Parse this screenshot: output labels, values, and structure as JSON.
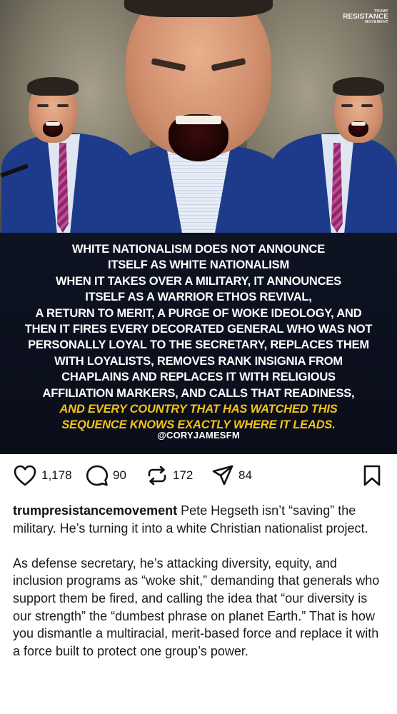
{
  "post_image": {
    "watermark": {
      "top": "TRUMP",
      "mid": "RESISTANCE",
      "bot": "MOVEMENT"
    },
    "quote_lines": [
      {
        "text": "WHITE NATIONALISM DOES NOT ANNOUNCE",
        "highlight": false
      },
      {
        "text": "ITSELF AS WHITE NATIONALISM",
        "highlight": false
      },
      {
        "text": "WHEN IT TAKES OVER A MILITARY, IT ANNOUNCES",
        "highlight": false
      },
      {
        "text": "ITSELF AS A WARRIOR ETHOS REVIVAL,",
        "highlight": false
      },
      {
        "text": "A RETURN TO MERIT, A PURGE OF WOKE IDEOLOGY, AND",
        "highlight": false
      },
      {
        "text": "THEN IT FIRES EVERY DECORATED GENERAL WHO WAS NOT",
        "highlight": false
      },
      {
        "text": "PERSONALLY LOYAL TO THE SECRETARY, REPLACES THEM",
        "highlight": false
      },
      {
        "text": "WITH LOYALISTS, REMOVES RANK INSIGNIA FROM",
        "highlight": false
      },
      {
        "text": "CHAPLAINS AND REPLACES IT WITH RELIGIOUS",
        "highlight": false
      },
      {
        "text": "AFFILIATION MARKERS, AND CALLS THAT READINESS,",
        "highlight": false
      },
      {
        "text": "AND EVERY COUNTRY THAT HAS WATCHED THIS",
        "highlight": true
      },
      {
        "text": "SEQUENCE KNOWS EXACTLY WHERE IT LEADS.",
        "highlight": true
      }
    ],
    "handle": "@CORYJAMESFM"
  },
  "actions": {
    "likes": "1,178",
    "comments": "90",
    "reposts": "172",
    "shares": "84",
    "icons": {
      "like": "heart-icon",
      "comment": "comment-icon",
      "repost": "repost-icon",
      "share": "send-icon",
      "save": "bookmark-icon"
    }
  },
  "caption": {
    "username": "trumpresistancemovement",
    "para1": " Pete Hegseth isn’t “saving” the military. He’s turning it into a white Christian nationalist project.",
    "para2": "As defense secretary, he’s attacking diversity, equity, and inclusion programs as “woke shit,” demanding that generals who support them be fired, and calling the idea that “our diversity is our strength” the “dumbest phrase on planet Earth.” That is how you dismantle a multiracial, merit-based force and replace it with a force built to protect one group’s power."
  },
  "colors": {
    "quote_background": "#0b0f1c",
    "quote_text": "#ffffff",
    "quote_highlight": "#f4c21a",
    "suit_blue": "#1d3b8a"
  }
}
